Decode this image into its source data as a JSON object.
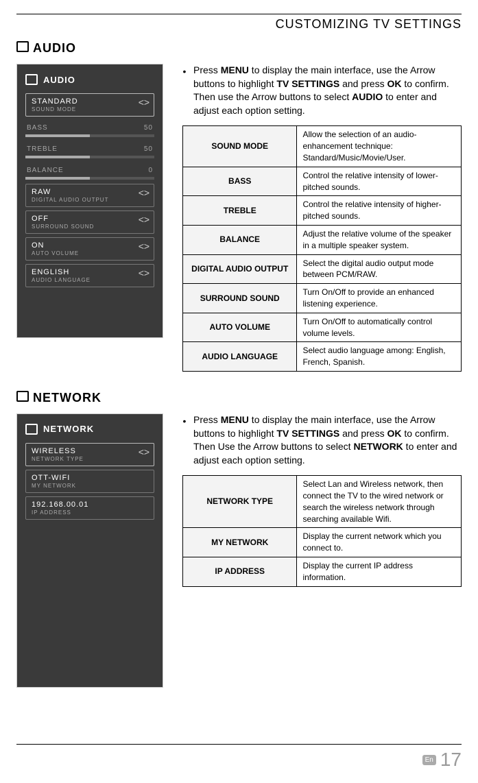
{
  "header": {
    "title": "CUSTOMIZING TV SETTINGS"
  },
  "audio": {
    "section_title": "AUDIO",
    "panel_title": "AUDIO",
    "nav_arrows": "< >",
    "items": {
      "sound_mode": {
        "value": "STANDARD",
        "label": "SOUND MODE"
      },
      "bass": {
        "label": "BASS",
        "value": "50",
        "pct": 50
      },
      "treble": {
        "label": "TREBLE",
        "value": "50",
        "pct": 50
      },
      "balance": {
        "label": "BALANCE",
        "value": "0",
        "pct": 50
      },
      "dao": {
        "value": "RAW",
        "label": "DIGITAL AUDIO OUTPUT"
      },
      "surround": {
        "value": "OFF",
        "label": "SURROUND SOUND"
      },
      "autovol": {
        "value": "ON",
        "label": "AUTO VOLUME"
      },
      "lang": {
        "value": "ENGLISH",
        "label": "AUDIO LANGUAGE"
      }
    },
    "instruction": {
      "pre": "Press ",
      "w1": "MENU",
      "mid1": " to display the main interface, use the Arrow buttons to highlight ",
      "w2": "TV SETTINGS",
      "mid2": " and press ",
      "w3": "OK",
      "mid3": " to confirm. Then use the Arrow buttons to select ",
      "w4": "AUDIO",
      "post": " to enter and adjust each option setting."
    },
    "table": [
      {
        "k": "SOUND MODE",
        "v": "Allow the selection of an audio-enhancement technique: Standard/Music/Movie/User."
      },
      {
        "k": "BASS",
        "v": "Control the relative intensity of lower-pitched sounds."
      },
      {
        "k": "TREBLE",
        "v": "Control the relative intensity of higher-pitched sounds."
      },
      {
        "k": "BALANCE",
        "v": "Adjust the relative volume of the speaker in a multiple speaker system."
      },
      {
        "k": "DIGITAL AUDIO OUTPUT",
        "v": "Select the digital audio output mode between PCM/RAW."
      },
      {
        "k": "SURROUND SOUND",
        "v": "Turn On/Off to provide an enhanced listening experience."
      },
      {
        "k": "AUTO VOLUME",
        "v": "Turn On/Off to automatically control volume levels."
      },
      {
        "k": "AUDIO LANGUAGE",
        "v": "Select audio language among: English, French, Spanish."
      }
    ]
  },
  "network": {
    "section_title": "NETWORK",
    "panel_title": "NETWORK",
    "nav_arrows": "< >",
    "items": {
      "ntype": {
        "value": "WIRELESS",
        "label": "NETWORK TYPE"
      },
      "mynet": {
        "value": "OTT-WIFI",
        "label": "MY NETWORK"
      },
      "ip": {
        "value": "192.168.00.01",
        "label": "IP ADDRESS"
      }
    },
    "instruction": {
      "pre": "Press ",
      "w1": "MENU",
      "mid1": " to display the main interface, use the Arrow buttons to highlight ",
      "w2": "TV SETTINGS",
      "mid2": " and press ",
      "w3": "OK",
      "mid3": " to confirm. Then Use the Arrow buttons to select ",
      "w4": "NETWORK",
      "post": " to enter and adjust each option setting."
    },
    "table": [
      {
        "k": "NETWORK TYPE",
        "v": "Select Lan and Wireless network, then connect the TV to the wired network or search the wireless network through searching available Wifi."
      },
      {
        "k": "MY NETWORK",
        "v": "Display the current network which you connect to."
      },
      {
        "k": "IP ADDRESS",
        "v": "Display the current IP address information."
      }
    ]
  },
  "footer": {
    "lang": "En",
    "page": "17"
  }
}
